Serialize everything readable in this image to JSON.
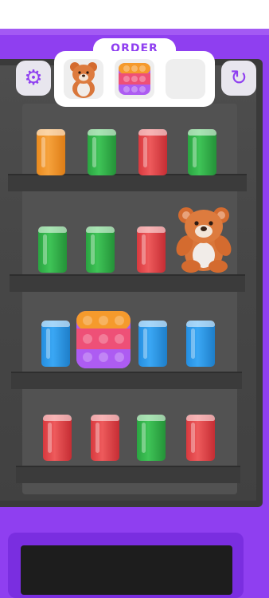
{
  "header": {
    "order_label": "ORDER",
    "settings_icon": "gear-icon",
    "restart_icon": "restart-icon"
  },
  "order_slots": [
    {
      "item": "teddy-bear"
    },
    {
      "item": "pop-it-fidget"
    },
    {
      "item": "empty"
    }
  ],
  "shelves": [
    {
      "items": [
        "orange-can",
        "green-can",
        "red-can",
        "green-can"
      ]
    },
    {
      "items": [
        "green-can",
        "green-can",
        "red-can",
        "teddy-bear"
      ]
    },
    {
      "items": [
        "blue-can",
        "pop-it-fidget",
        "blue-can",
        "blue-can"
      ]
    },
    {
      "items": [
        "red-can",
        "red-can",
        "green-can",
        "red-can"
      ]
    }
  ],
  "colors": {
    "machine": "#8f3ff0",
    "orange_can": "#f6a23c",
    "green_can": "#3fc457",
    "red_can": "#ee5a5c",
    "blue_can": "#3aa7f4",
    "bear": "#d9763a"
  }
}
